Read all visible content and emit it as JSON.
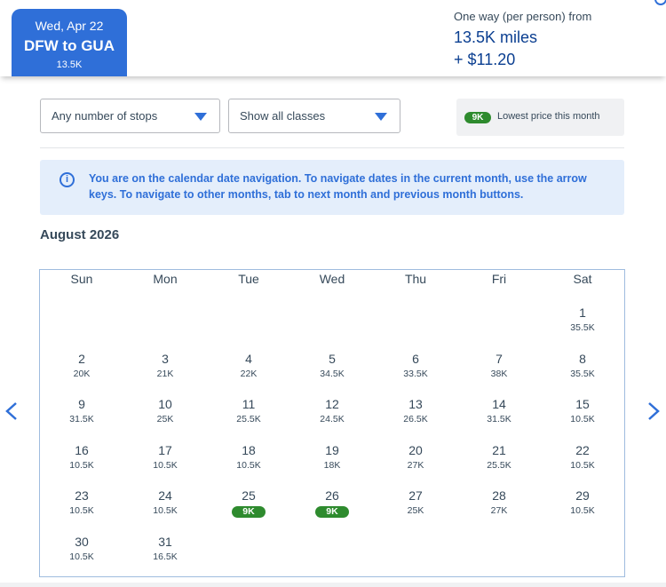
{
  "header": {
    "date_label": "Wed, Apr 22",
    "route": "DFW to GUA",
    "route_price": "13.5K",
    "fare_label": "One way (per person) from",
    "miles": "13.5K miles",
    "taxes": "+ $11.20"
  },
  "filters": {
    "stops": "Any number of stops",
    "classes": "Show all classes"
  },
  "legend": {
    "badge": "9K",
    "label": "Lowest price this month"
  },
  "info": {
    "icon": "info-icon",
    "message": "You are on the calendar date navigation. To navigate dates in the current month, use the arrow keys. To navigate to other months, tab to next month and previous month buttons."
  },
  "calendar": {
    "month_label": "August 2026",
    "weekdays": [
      "Sun",
      "Mon",
      "Tue",
      "Wed",
      "Thu",
      "Fri",
      "Sat"
    ],
    "days": [
      {
        "day": "1",
        "price": "35.5K",
        "low": false
      },
      {
        "day": "2",
        "price": "20K",
        "low": false
      },
      {
        "day": "3",
        "price": "21K",
        "low": false
      },
      {
        "day": "4",
        "price": "22K",
        "low": false
      },
      {
        "day": "5",
        "price": "34.5K",
        "low": false
      },
      {
        "day": "6",
        "price": "33.5K",
        "low": false
      },
      {
        "day": "7",
        "price": "38K",
        "low": false
      },
      {
        "day": "8",
        "price": "35.5K",
        "low": false
      },
      {
        "day": "9",
        "price": "31.5K",
        "low": false
      },
      {
        "day": "10",
        "price": "25K",
        "low": false
      },
      {
        "day": "11",
        "price": "25.5K",
        "low": false
      },
      {
        "day": "12",
        "price": "24.5K",
        "low": false
      },
      {
        "day": "13",
        "price": "26.5K",
        "low": false
      },
      {
        "day": "14",
        "price": "31.5K",
        "low": false
      },
      {
        "day": "15",
        "price": "10.5K",
        "low": false
      },
      {
        "day": "16",
        "price": "10.5K",
        "low": false
      },
      {
        "day": "17",
        "price": "10.5K",
        "low": false
      },
      {
        "day": "18",
        "price": "10.5K",
        "low": false
      },
      {
        "day": "19",
        "price": "18K",
        "low": false
      },
      {
        "day": "20",
        "price": "27K",
        "low": false
      },
      {
        "day": "21",
        "price": "25.5K",
        "low": false
      },
      {
        "day": "22",
        "price": "10.5K",
        "low": false
      },
      {
        "day": "23",
        "price": "10.5K",
        "low": false
      },
      {
        "day": "24",
        "price": "10.5K",
        "low": false
      },
      {
        "day": "25",
        "price": "9K",
        "low": true
      },
      {
        "day": "26",
        "price": "9K",
        "low": true
      },
      {
        "day": "27",
        "price": "25K",
        "low": false
      },
      {
        "day": "28",
        "price": "27K",
        "low": false
      },
      {
        "day": "29",
        "price": "10.5K",
        "low": false
      },
      {
        "day": "30",
        "price": "10.5K",
        "low": false
      },
      {
        "day": "31",
        "price": "16.5K",
        "low": false
      }
    ]
  },
  "nav": {
    "prev_icon": "chevron-left-icon",
    "next_icon": "chevron-right-icon"
  },
  "colors": {
    "accent": "#2f6fd8",
    "low_price": "#2e8b2e",
    "info_bg": "#e4eefb"
  }
}
